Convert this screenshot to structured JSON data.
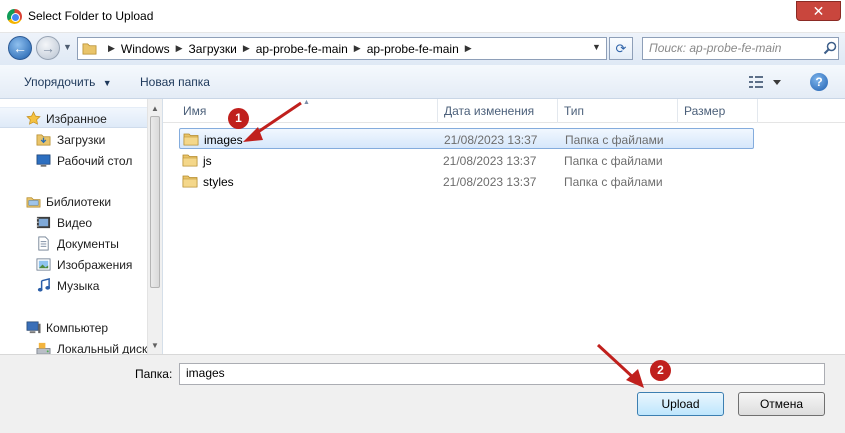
{
  "window": {
    "title": "Select Folder to Upload",
    "close_label": "✕"
  },
  "nav": {
    "back_icon": "back-arrow-icon",
    "forward_icon": "forward-arrow-icon",
    "breadcrumbs": [
      "Windows",
      "Загрузки",
      "ap-probe-fe-main",
      "ap-probe-fe-main"
    ],
    "search_placeholder": "Поиск: ap-probe-fe-main"
  },
  "toolbar": {
    "organize_label": "Упорядочить",
    "new_folder_label": "Новая папка"
  },
  "sidebar": {
    "items": [
      {
        "label": "Избранное",
        "icon": "star-icon"
      },
      {
        "label": "Загрузки",
        "icon": "downloads-folder-icon"
      },
      {
        "label": "Рабочий стол",
        "icon": "desktop-icon"
      },
      {
        "label": "Библиотеки",
        "icon": "libraries-icon"
      },
      {
        "label": "Видео",
        "icon": "video-icon"
      },
      {
        "label": "Документы",
        "icon": "documents-icon"
      },
      {
        "label": "Изображения",
        "icon": "pictures-icon"
      },
      {
        "label": "Музыка",
        "icon": "music-icon"
      },
      {
        "label": "Компьютер",
        "icon": "computer-icon"
      },
      {
        "label": "Локальный диск",
        "icon": "local-disk-icon"
      }
    ]
  },
  "filelist": {
    "columns": [
      "Имя",
      "Дата изменения",
      "Тип",
      "Размер"
    ],
    "rows": [
      {
        "name": "images",
        "date": "21/08/2023 13:37",
        "type": "Папка с файлами",
        "selected": true
      },
      {
        "name": "js",
        "date": "21/08/2023 13:37",
        "type": "Папка с файлами",
        "selected": false
      },
      {
        "name": "styles",
        "date": "21/08/2023 13:37",
        "type": "Папка с файлами",
        "selected": false
      }
    ]
  },
  "footer": {
    "folder_label": "Папка:",
    "folder_value": "images",
    "upload_label": "Upload",
    "cancel_label": "Отмена"
  },
  "annotations": {
    "badge1": "1",
    "badge2": "2",
    "color": "#c0201d"
  },
  "colors": {
    "selection": "#d6e7fb",
    "accent": "#3c7fb1"
  }
}
